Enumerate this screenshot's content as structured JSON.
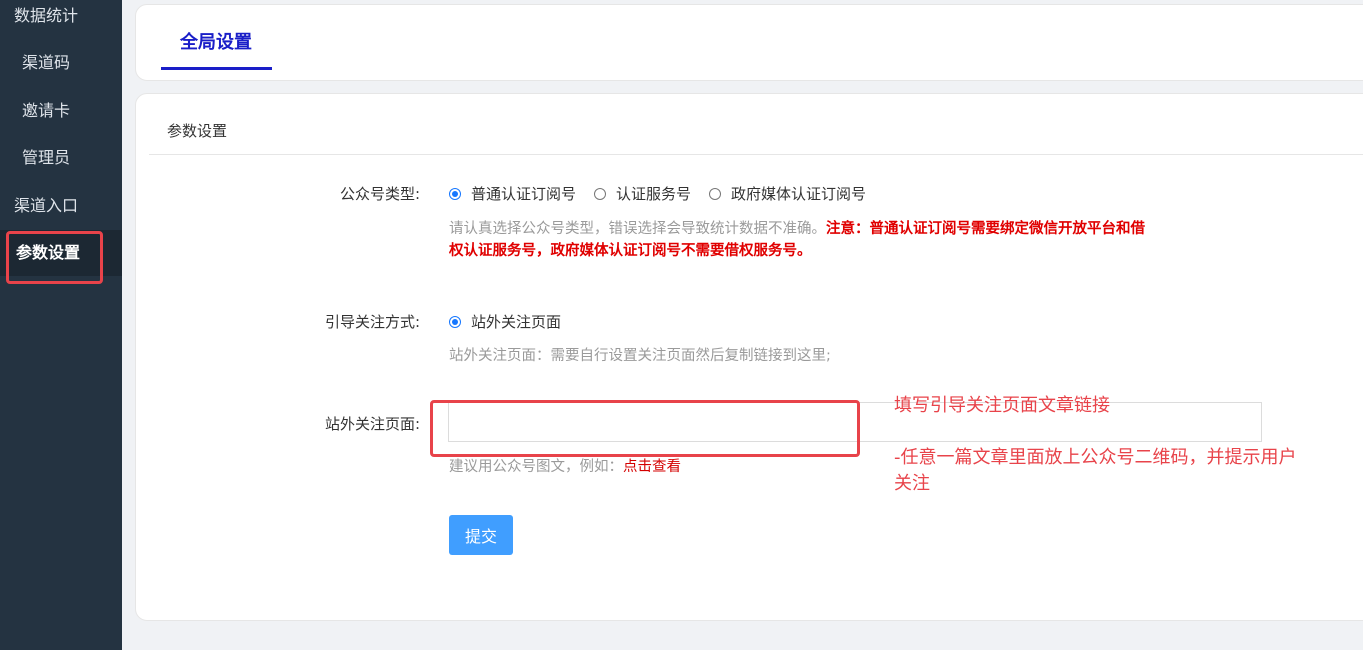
{
  "sidebar": {
    "items": [
      {
        "label": "数据统计"
      },
      {
        "label": "渠道码"
      },
      {
        "label": "邀请卡"
      },
      {
        "label": "管理员"
      },
      {
        "label": "渠道入口"
      },
      {
        "label": "参数设置"
      }
    ],
    "active_index": 5
  },
  "tabs": [
    {
      "label": "全局设置",
      "active": true
    }
  ],
  "form": {
    "section_title": "参数设置",
    "account_type": {
      "label": "公众号类型:",
      "options": [
        "普通认证订阅号",
        "认证服务号",
        "政府媒体认证订阅号"
      ],
      "selected_index": 0,
      "hint_normal": "请认真选择公众号类型，错误选择会导致统计数据不准确。",
      "hint_warn_1": "注意：普通认证订阅号需要绑定微信开放平台和借",
      "hint_warn_2": "权认证服务号，政府媒体认证订阅号不需要借权服务号。"
    },
    "follow_method": {
      "label": "引导关注方式:",
      "option": "站外关注页面",
      "hint": "站外关注页面：需要自行设置关注页面然后复制链接到这里;"
    },
    "external_page": {
      "label": "站外关注页面:",
      "value": "",
      "hint": "建议用公众号图文，例如：",
      "hint_link": "点击查看"
    },
    "submit_label": "提交"
  },
  "annotations": {
    "line1": "填写引导关注页面文章链接",
    "line2": "-任意一篇文章里面放上公众号二维码，并提示用户",
    "line3": "关注"
  },
  "colors": {
    "sidebar_bg": "#243341",
    "accent_blue": "#1a1ec8",
    "radio_blue": "#1677ff",
    "warn_red": "#e00000",
    "annotation_red": "#e8434a",
    "button_blue": "#409eff"
  }
}
